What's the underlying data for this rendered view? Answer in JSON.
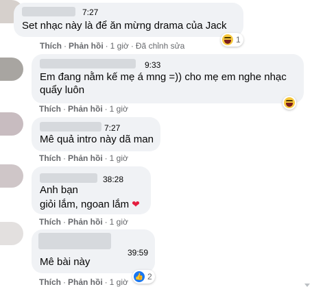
{
  "comments": [
    {
      "time": "7:27",
      "text": "Set nhạc này là để ăn mừng drama của Jack",
      "actions": {
        "like": "Thích",
        "reply": "Phản hồi",
        "age": "1 giờ",
        "edited": "Đã chỉnh sửa"
      },
      "reaction": {
        "icon": "haha-icon",
        "count": "1"
      }
    },
    {
      "time": "9:33",
      "text_line1": "Em đang nằm kế mẹ á mng =)) cho mẹ em nghe nhạc",
      "text_line2": "quẩy luôn",
      "actions": {
        "like": "Thích",
        "reply": "Phản hồi",
        "age": "1 giờ"
      },
      "reaction": {
        "icon": "haha-icon",
        "count": ""
      }
    },
    {
      "time": "7:27",
      "text": "Mê quả intro này dã man",
      "actions": {
        "like": "Thích",
        "reply": "Phản hồi",
        "age": "1 giờ"
      }
    },
    {
      "time": "38:28",
      "text_line1": "Anh bạn",
      "text_line2": "giỏi lắm, ngoan lắm",
      "actions": {
        "like": "Thích",
        "reply": "Phản hồi",
        "age": "1 giờ"
      }
    },
    {
      "time": "39:59",
      "text": "Mê bài này",
      "actions": {
        "like": "Thích",
        "reply": "Phản hồi",
        "age": "1 giờ"
      },
      "reaction": {
        "icon": "like-icon",
        "count": "2"
      }
    }
  ],
  "separator": "·",
  "colors": {
    "bubble": "#f0f2f5",
    "meta": "#65676b",
    "heart": "#e41e3f",
    "like": "#1877f2",
    "haha": "#f7c93e"
  }
}
